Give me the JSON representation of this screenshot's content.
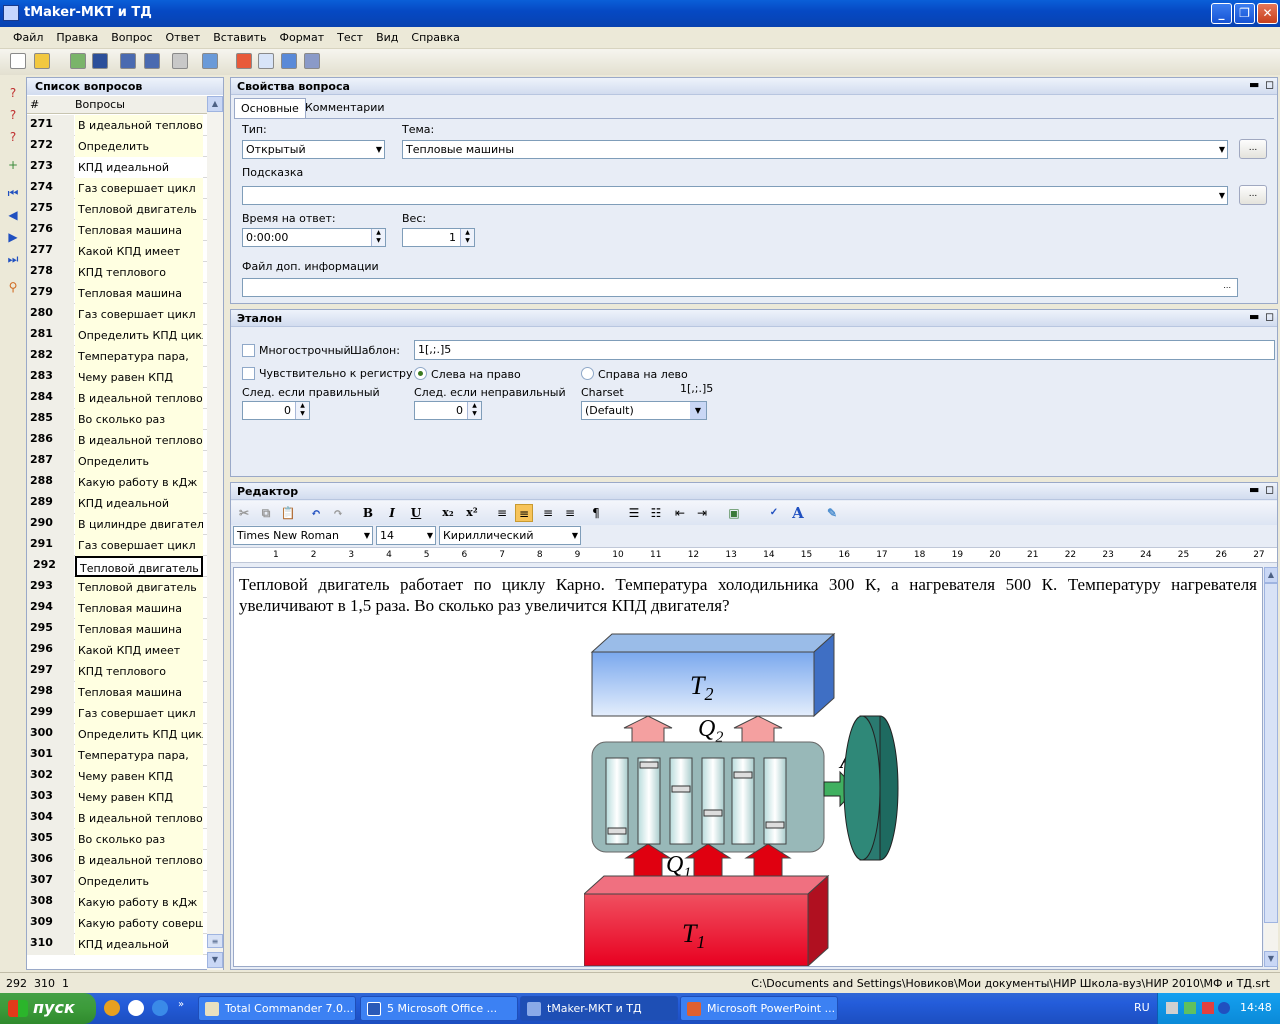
{
  "window": {
    "title": "tMaker-МКТ и ТД"
  },
  "menu": [
    "Файл",
    "Правка",
    "Вопрос",
    "Ответ",
    "Вставить",
    "Формат",
    "Тест",
    "Вид",
    "Справка"
  ],
  "questions": {
    "title": "Список вопросов",
    "col_num": "#",
    "col_q": "Вопросы",
    "rows": [
      {
        "n": "271",
        "t": "В идеальной тепловой"
      },
      {
        "n": "272",
        "t": "Определить"
      },
      {
        "n": "273",
        "t": "КПД идеальной"
      },
      {
        "n": "274",
        "t": "Газ совершает цикл"
      },
      {
        "n": "275",
        "t": "Тепловой двигатель"
      },
      {
        "n": "276",
        "t": "Тепловая машина"
      },
      {
        "n": "277",
        "t": "Какой КПД имеет"
      },
      {
        "n": "278",
        "t": "КПД теплового"
      },
      {
        "n": "279",
        "t": "Тепловая машина"
      },
      {
        "n": "280",
        "t": "Газ совершает цикл"
      },
      {
        "n": "281",
        "t": "Определить КПД цикла"
      },
      {
        "n": "282",
        "t": "Температура пара,"
      },
      {
        "n": "283",
        "t": "Чему равен КПД"
      },
      {
        "n": "284",
        "t": "В идеальной тепловой"
      },
      {
        "n": "285",
        "t": "Во сколько раз"
      },
      {
        "n": "286",
        "t": "В идеальной тепловой"
      },
      {
        "n": "287",
        "t": "Определить"
      },
      {
        "n": "288",
        "t": "Какую работу в кДж"
      },
      {
        "n": "289",
        "t": "КПД идеальной"
      },
      {
        "n": "290",
        "t": "В цилиндре двигателя"
      },
      {
        "n": "291",
        "t": "Газ совершает цикл"
      },
      {
        "n": "292",
        "t": "Тепловой двигатель"
      },
      {
        "n": "293",
        "t": "Тепловой двигатель"
      },
      {
        "n": "294",
        "t": "Тепловая машина"
      },
      {
        "n": "295",
        "t": "Тепловая машина"
      },
      {
        "n": "296",
        "t": "Какой КПД имеет"
      },
      {
        "n": "297",
        "t": "КПД теплового"
      },
      {
        "n": "298",
        "t": "Тепловая машина"
      },
      {
        "n": "299",
        "t": "Газ совершает цикл"
      },
      {
        "n": "300",
        "t": "Определить КПД цикла"
      },
      {
        "n": "301",
        "t": "Температура пара,"
      },
      {
        "n": "302",
        "t": "Чему равен КПД"
      },
      {
        "n": "303",
        "t": "Чему равен КПД"
      },
      {
        "n": "304",
        "t": "В идеальной тепловой"
      },
      {
        "n": "305",
        "t": "Во сколько раз"
      },
      {
        "n": "306",
        "t": "В идеальной тепловой"
      },
      {
        "n": "307",
        "t": "Определить"
      },
      {
        "n": "308",
        "t": "Какую работу в кДж"
      },
      {
        "n": "309",
        "t": "Какую работу совершил"
      },
      {
        "n": "310",
        "t": "КПД идеальной"
      }
    ]
  },
  "props": {
    "title": "Свойства вопроса",
    "tab_main": "Основные",
    "tab_comments": "Комментарии",
    "type_label": "Тип:",
    "type_value": "Открытый",
    "topic_label": "Тема:",
    "topic_value": "Тепловые машины",
    "hint_label": "Подсказка",
    "hint_value": "",
    "time_label": "Время на ответ:",
    "time_value": "0:00:00",
    "weight_label": "Вес:",
    "weight_value": "1",
    "file_label": "Файл доп. информации",
    "file_value": "",
    "ellipsis": "..."
  },
  "etalon": {
    "title": "Эталон",
    "multiline": "Многострочный",
    "template_label": "Шаблон:",
    "template_value": "1[,;.]5",
    "case": "Чувствительно к регистру",
    "ltr": "Слева на право",
    "rtl": "Справа на лево",
    "next_right": "След. если правильный",
    "next_wrong": "След. если неправильный",
    "charset_label": "Charset",
    "charset_preview": "1[,;.]5",
    "next_right_value": "0",
    "next_wrong_value": "0",
    "charset_value": "(Default)"
  },
  "editor": {
    "title": "Редактор",
    "font": "Times New Roman",
    "size": "14",
    "script": "Кириллический",
    "ruler": [
      "1",
      "2",
      "3",
      "4",
      "5",
      "6",
      "7",
      "8",
      "9",
      "10",
      "11",
      "12",
      "13",
      "14",
      "15",
      "16",
      "17",
      "18",
      "19",
      "20",
      "21",
      "22",
      "23",
      "24",
      "25",
      "26",
      "27"
    ],
    "text": "Тепловой двигатель работает по циклу Карно. Температура холодильника  300 К, а нагревателя 500 К. Температуру нагревателя увеличивают в 1,5 раза. Во сколько раз увеличится КПД двигателя?",
    "fig_t2": "T",
    "fig_t2_sub": "2",
    "fig_q2": "Q",
    "fig_q2_sub": "2",
    "fig_q1": "Q",
    "fig_q1_sub": "1",
    "fig_t1": "T",
    "fig_t1_sub": "1",
    "fig_a": "A"
  },
  "status": {
    "current": "292",
    "total": "310",
    "third": "1",
    "path": "C:\\Documents and Settings\\Новиков\\Мои документы\\НИР Школа-вуз\\НИР 2010\\МФ и ТД.srt"
  },
  "taskbar": {
    "start": "пуск",
    "tasks": [
      "Total Commander 7.0...",
      "5 Microsoft Office ...",
      "tMaker-МКТ и ТД",
      "Microsoft PowerPoint ..."
    ],
    "lang": "RU",
    "time": "14:48"
  }
}
